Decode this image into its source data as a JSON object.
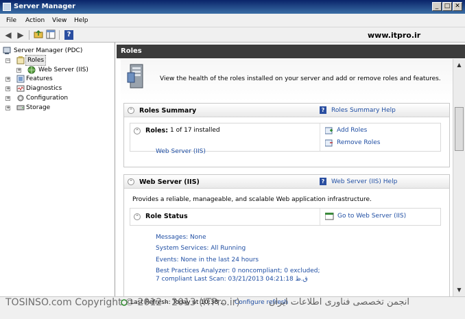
{
  "window": {
    "title": "Server Manager",
    "min": "_",
    "max": "□",
    "close": "✕"
  },
  "menu": [
    "File",
    "Action",
    "View",
    "Help"
  ],
  "watermark_top": "www.itpro.ir",
  "tree": {
    "root": "Server Manager (PDC)",
    "roles": "Roles",
    "web_server": "Web Server (IIS)",
    "features": "Features",
    "diagnostics": "Diagnostics",
    "configuration": "Configuration",
    "storage": "Storage"
  },
  "content": {
    "header": "Roles",
    "intro": "View the health of the roles installed on your server and add or remove roles and features.",
    "roles_summary": {
      "title": "Roles Summary",
      "help": "Roles Summary Help",
      "roles_label": "Roles:",
      "roles_count": "1 of 17 installed",
      "installed_role": "Web Server (IIS)",
      "add_roles": "Add Roles",
      "remove_roles": "Remove Roles"
    },
    "web_server": {
      "title": "Web Server (IIS)",
      "help": "Web Server (IIS) Help",
      "description": "Provides a reliable, manageable, and scalable Web application infrastructure.",
      "role_status": "Role Status",
      "goto": "Go to Web Server (IIS)",
      "messages": "Messages: None",
      "services": "System Services: All Running",
      "events": "Events: None in the last 24 hours",
      "bpa_line1": "Best Practices Analyzer: 0 noncompliant; 0 excluded;",
      "bpa_line2": "7 compliant   Last Scan: 03/21/2013 04:21:18 ق.ظ"
    }
  },
  "status": {
    "last_refresh": "Last Refresh: Today at 10:38 ...",
    "configure_refresh": "Configure refresh",
    "copyright": "TOSINSO.com Copyright © 2012 - 2013 (ITPro.ir)",
    "persian": "انجمن تخصصی فناوری اطلاعات ایران"
  },
  "colors": {
    "title_start": "#0a246a",
    "title_end": "#3a6ea5",
    "header_bar": "#3c3c3c",
    "link": "#1f4ea3"
  }
}
